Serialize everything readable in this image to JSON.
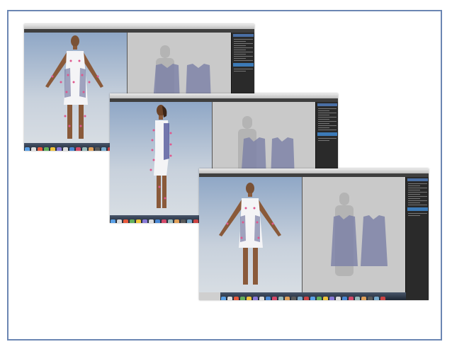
{
  "window": {
    "app_title": ""
  },
  "screens": [
    "front-view",
    "side-view",
    "front-view-final"
  ],
  "colors": {
    "frame_border": "#6b86b3",
    "dress_fill": "#7a7fa6",
    "panel_bg": "#2a2a2a",
    "accent": "#3c7ab7",
    "measure_point": "#e0568c"
  }
}
